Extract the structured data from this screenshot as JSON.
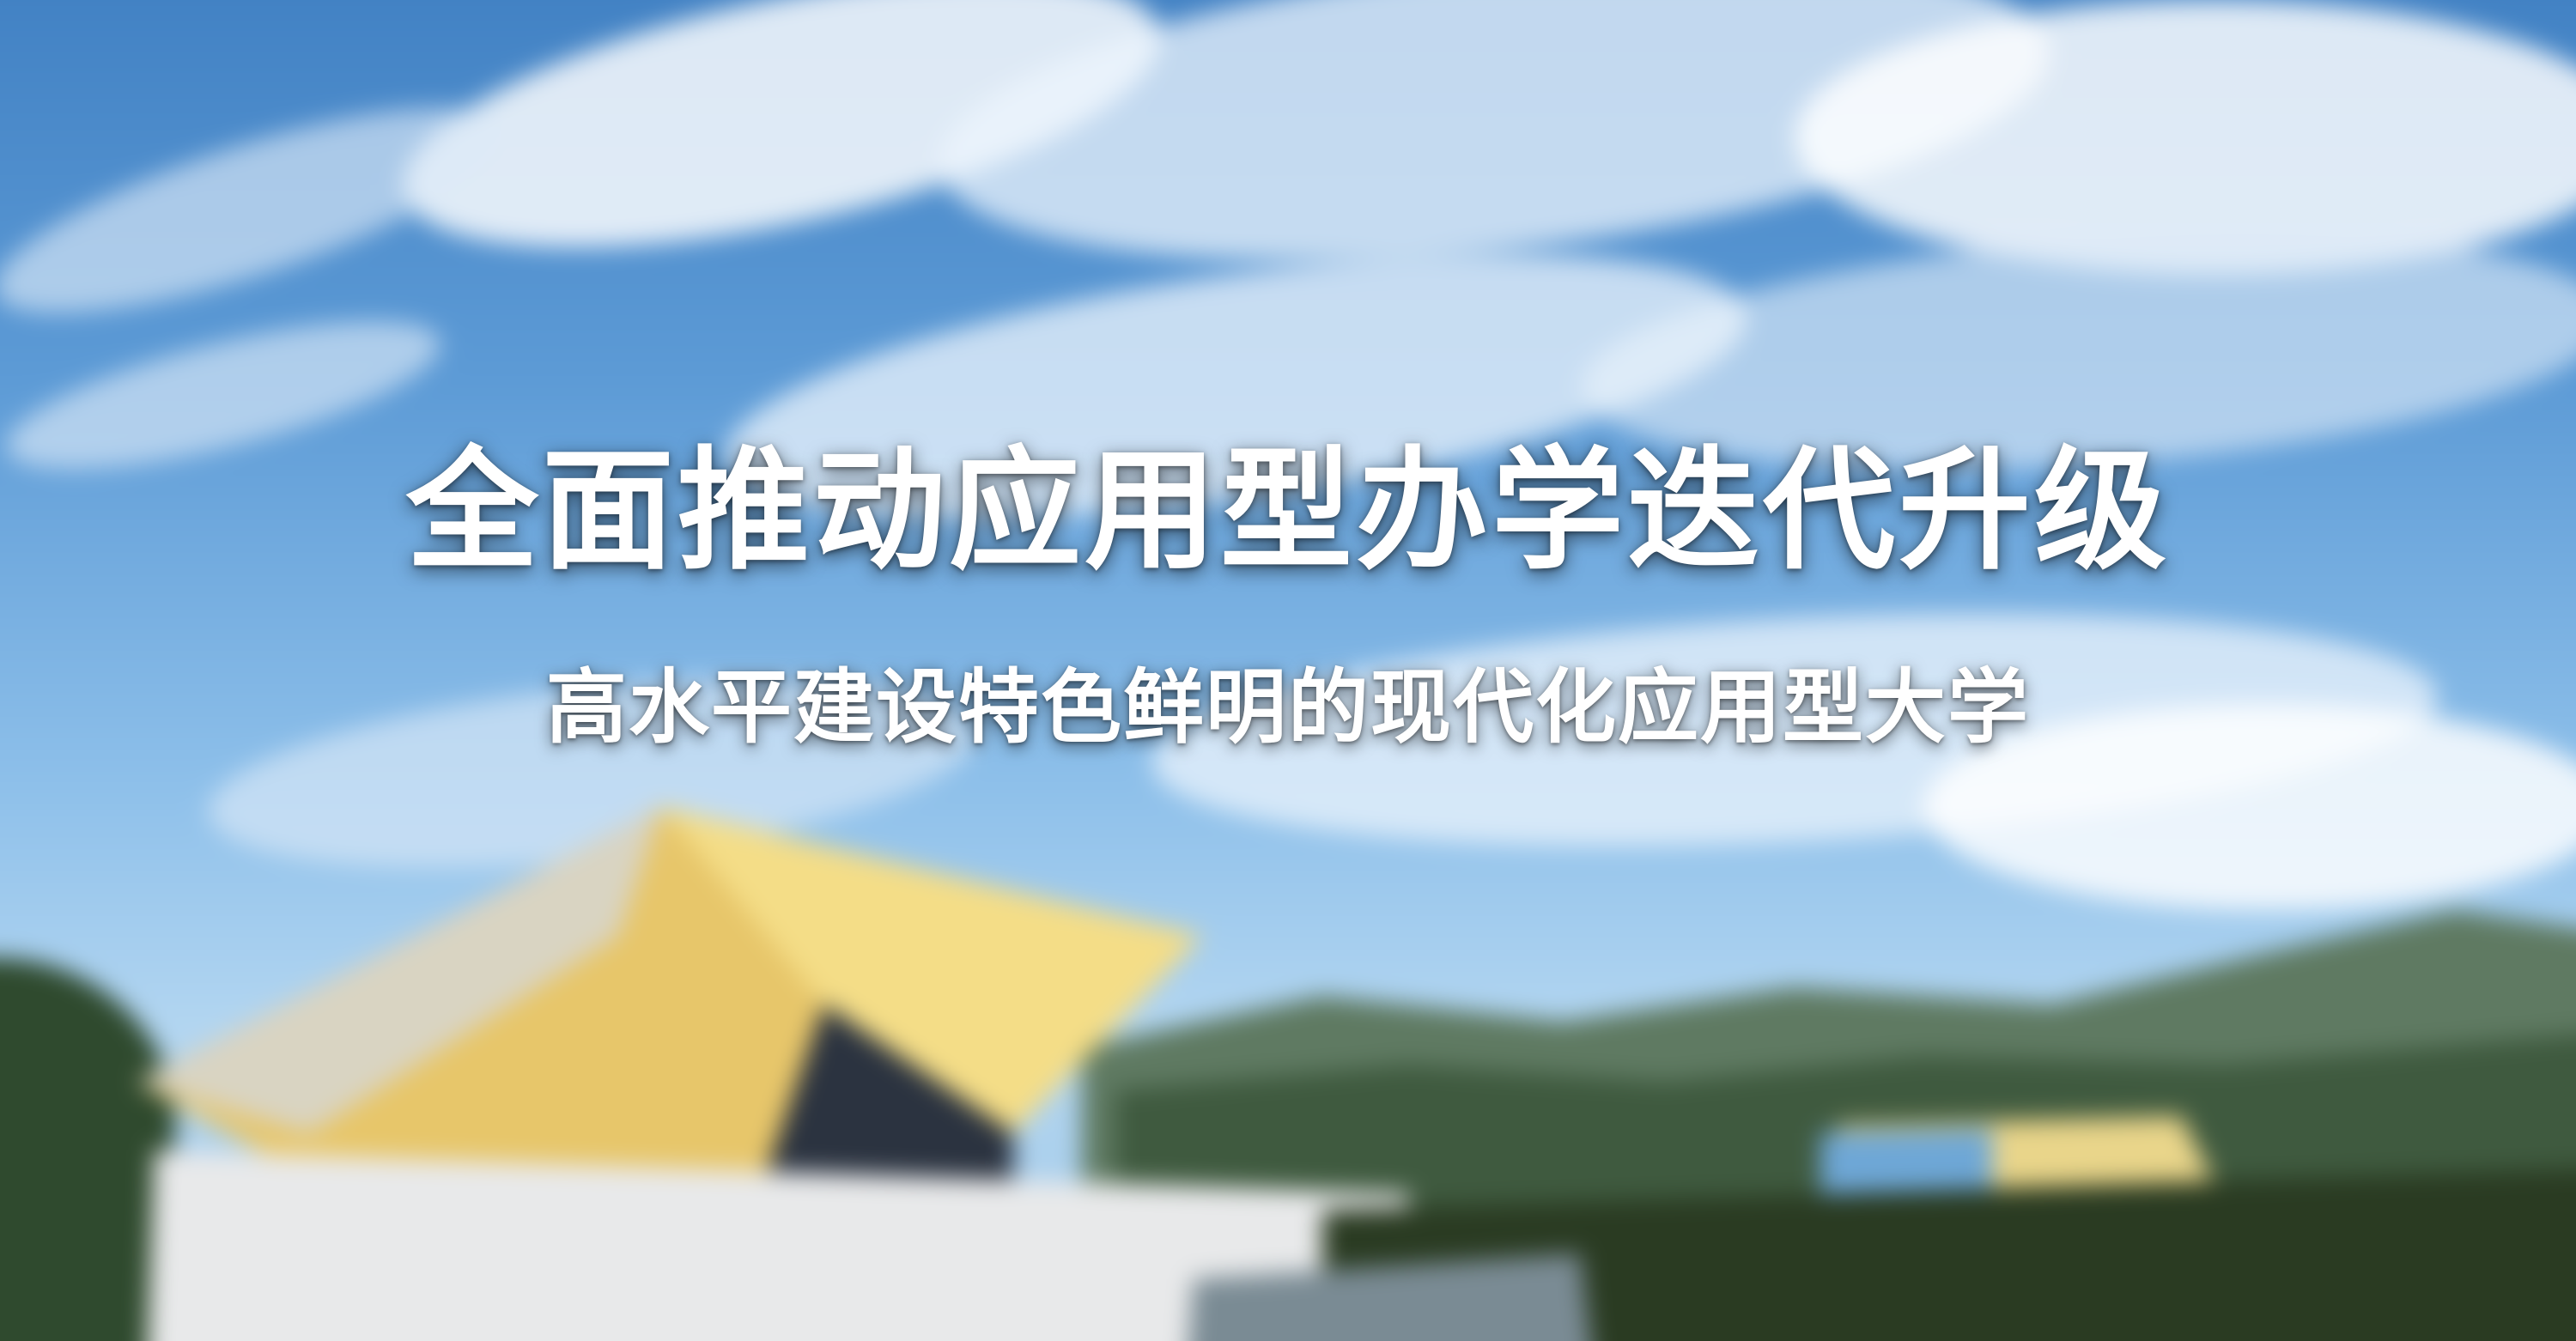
{
  "banner": {
    "headline": "全面推动应用型办学迭代升级",
    "subline": "高水平建设特色鲜明的现代化应用型大学"
  },
  "scene": {
    "background_description_visible": false,
    "sky_color": "#5d9bd6",
    "cloud_color": "#ffffff",
    "roof_color": "#f0d377",
    "mountain_color": "#4f6b52"
  }
}
